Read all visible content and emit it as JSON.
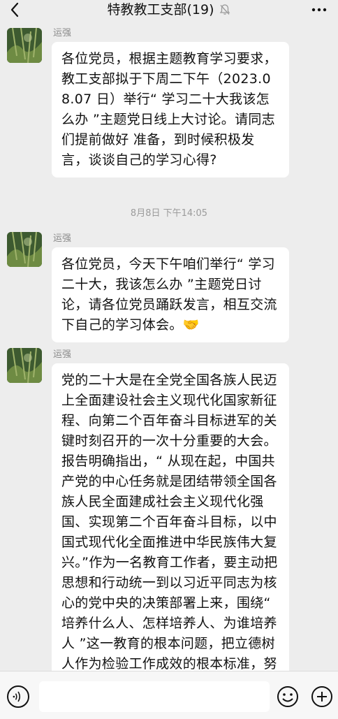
{
  "header": {
    "title": "特教教工支部(19)",
    "icons": [
      "back-icon",
      "mute-bell-icon",
      "more-icon"
    ]
  },
  "messages": [
    {
      "sender": "运强",
      "text": "各位党员，根据主题教育学习要求，教工支部拟于下周二下午（2023.08.07 日）举行“ 学习二十大我该怎么办 ”主题党日线上大讨论。请同志们提前做好 准备，到时候积极发言，谈谈自己的学习心得?"
    },
    {
      "timestamp": "8月8日 下午14:05"
    },
    {
      "sender": "运强",
      "text": "各位党员，今天下午咱们举行“ 学习二十大，我该怎么办 ”主题党日讨论，请各位党员踊跃发言，相互交流下自己的学习体会。🤝"
    },
    {
      "sender": "运强",
      "text": "党的二十大是在全党全国各族人民迈上全面建设社会主义现代化国家新征程、向第二个百年奋斗目标进军的关键时刻召开的一次十分重要的大会。报告明确指出，“ 从现在起，中国共产党的中心任务就是团结带领全国各族人民全面建成社会主义现代化强国、实现第二个百年奋斗目标，以中国式现代化全面推进中华民族伟大复兴。”作为一名教育工作者，要主动把思想和行动统一到以习近平同志为核心的党中央的决策部署上来，围绕“ 培养什么人、怎样培养人、为谁培养人 ”这一教育的根本问题，把立德树人作为检验工作成效的根本标准，努"
    }
  ],
  "input_bar": {
    "icons": [
      "voice-icon",
      "emoji-icon",
      "plus-icon"
    ],
    "text_value": ""
  }
}
